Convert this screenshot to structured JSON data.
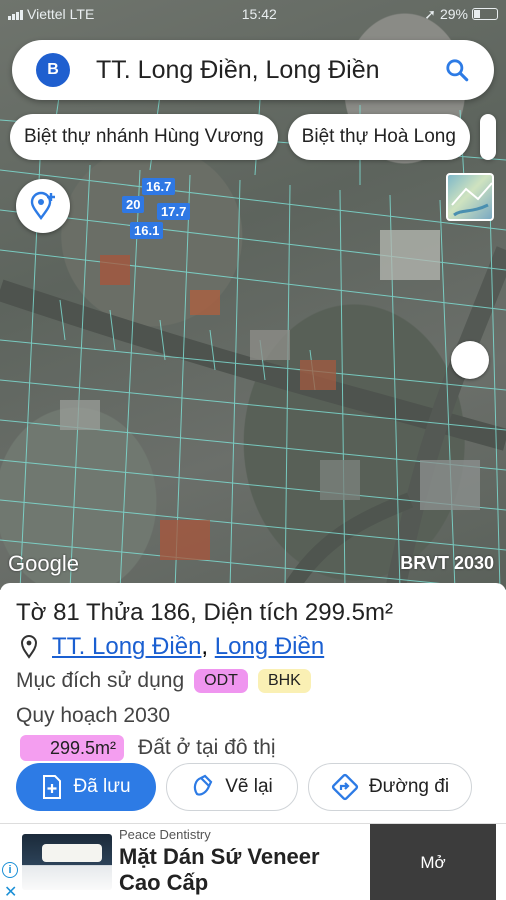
{
  "status_bar": {
    "carrier": "Viettel",
    "network": "LTE",
    "time": "15:42",
    "battery": "29%"
  },
  "search": {
    "avatar_letter": "B",
    "query": "TT. Long Điền, Long Điền"
  },
  "chips": [
    {
      "label": "Biệt thự nhánh Hùng Vương"
    },
    {
      "label": "Biệt thự Hoà Long"
    }
  ],
  "map": {
    "dimensions": [
      "16.7",
      "20",
      "17.7",
      "16.1"
    ],
    "google_logo": "Google",
    "watermark": "BRVT 2030"
  },
  "parcel": {
    "sheet_label": "Tờ",
    "sheet_no": "81",
    "plot_label": "Thửa",
    "plot_no": "186",
    "area_label": "Diện tích",
    "area_value": "299.5",
    "area_unit": "m²",
    "ward": "TT. Long Điền",
    "district": "Long Điền",
    "purpose_label": "Mục đích sử dụng",
    "tags": [
      "ODT",
      "BHK"
    ],
    "plan_label": "Quy hoạch 2030",
    "plan_area": "299.5m²",
    "plan_desc": "Đất ở tại đô thị"
  },
  "actions": {
    "saved": "Đã lưu",
    "redraw": "Vẽ lại",
    "route": "Đường đi"
  },
  "ad": {
    "brand": "Peace Dentistry",
    "headline": "Mặt Dán Sứ Veneer Cao Cấp",
    "cta": "Mở"
  },
  "colors": {
    "accent": "#2d7be5",
    "odt_tag": "#ef95ef",
    "bhk_tag": "#faf0b4",
    "link": "#1a5fd1"
  }
}
